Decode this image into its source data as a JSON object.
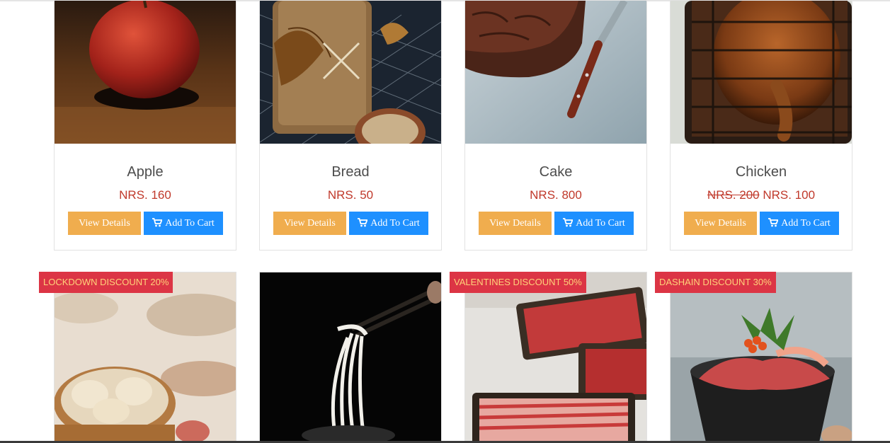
{
  "products": [
    {
      "name": "Apple",
      "price": "NRS. 160",
      "old_price": "",
      "image": "apple-image"
    },
    {
      "name": "Bread",
      "price": "NRS. 50",
      "old_price": "",
      "image": "bread-image"
    },
    {
      "name": "Cake",
      "price": "NRS. 800",
      "old_price": "",
      "image": "cake-image"
    },
    {
      "name": "Chicken",
      "price": "NRS. 100",
      "old_price": "NRS. 200",
      "image": "chicken-image"
    }
  ],
  "buttons": {
    "view_details": "View Details",
    "add_to_cart": "Add To Cart"
  },
  "badges": {
    "dumplings": "LOCKDOWN DISCOUNT 20%",
    "meat": "VALENTINES DISCOUNT 50%",
    "poke": "DASHAIN DISCOUNT 30%"
  },
  "icons": {
    "cart": "shopping-cart-icon"
  },
  "colors": {
    "view_button": "#f0ad4e",
    "cart_button": "#1e90ff",
    "price": "#c0392b",
    "badge_bg": "#dc3545",
    "badge_text": "#ffd27a"
  }
}
